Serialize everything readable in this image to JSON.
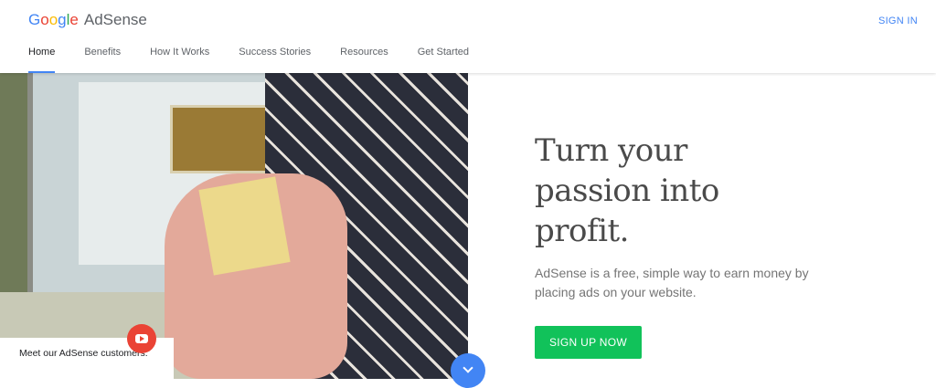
{
  "header": {
    "logo_brand": "Google",
    "logo_product": "AdSense",
    "sign_in": "SIGN IN"
  },
  "nav": {
    "items": [
      {
        "label": "Home",
        "active": true
      },
      {
        "label": "Benefits"
      },
      {
        "label": "How It Works"
      },
      {
        "label": "Success Stories"
      },
      {
        "label": "Resources"
      },
      {
        "label": "Get Started"
      }
    ]
  },
  "hero": {
    "headline": "Turn your\npassion into\nprofit.",
    "subtext": "AdSense is a free, simple way to earn money by placing ads on your website.",
    "cta": "SIGN UP NOW",
    "video_caption": "Meet our AdSense customers.",
    "play_icon": "youtube-play-icon",
    "scroll_icon": "chevron-down-icon"
  },
  "colors": {
    "accent_blue": "#4285f4",
    "cta_green": "#11c25a",
    "play_red": "#ea4335"
  }
}
